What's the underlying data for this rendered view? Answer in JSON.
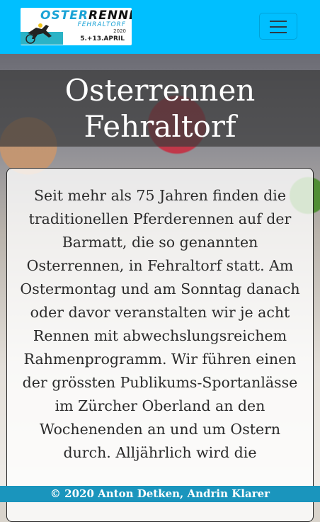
{
  "logo": {
    "line1_a": "OSTER",
    "line1_b": "RENNEN",
    "line2": "FEHRALTORF",
    "line3": "2020",
    "line4": "5.+13.APRIL"
  },
  "hero": {
    "title": "Osterrennen Fehraltorf"
  },
  "intro": {
    "text": "Seit mehr als 75 Jahren finden die traditionellen Pferderennen auf der Barmatt, die so genannten Osterrennen, in Fehraltorf statt. Am Ostermontag und am Sonntag danach oder davor veranstalten wir je acht Rennen mit abwechslungsreichem Rahmenprogramm. Wir führen einen der grössten Publikums-Sportanlässe im Zürcher Oberland an den Wochenenden an und um Ostern durch. Alljährlich wird die"
  },
  "footer": {
    "text": "© 2020 Anton Detken, Andrin Klarer"
  },
  "colors": {
    "navbar": "#00bfff",
    "footer": "#1a95bd"
  },
  "icons": {
    "menu": "hamburger-icon"
  }
}
